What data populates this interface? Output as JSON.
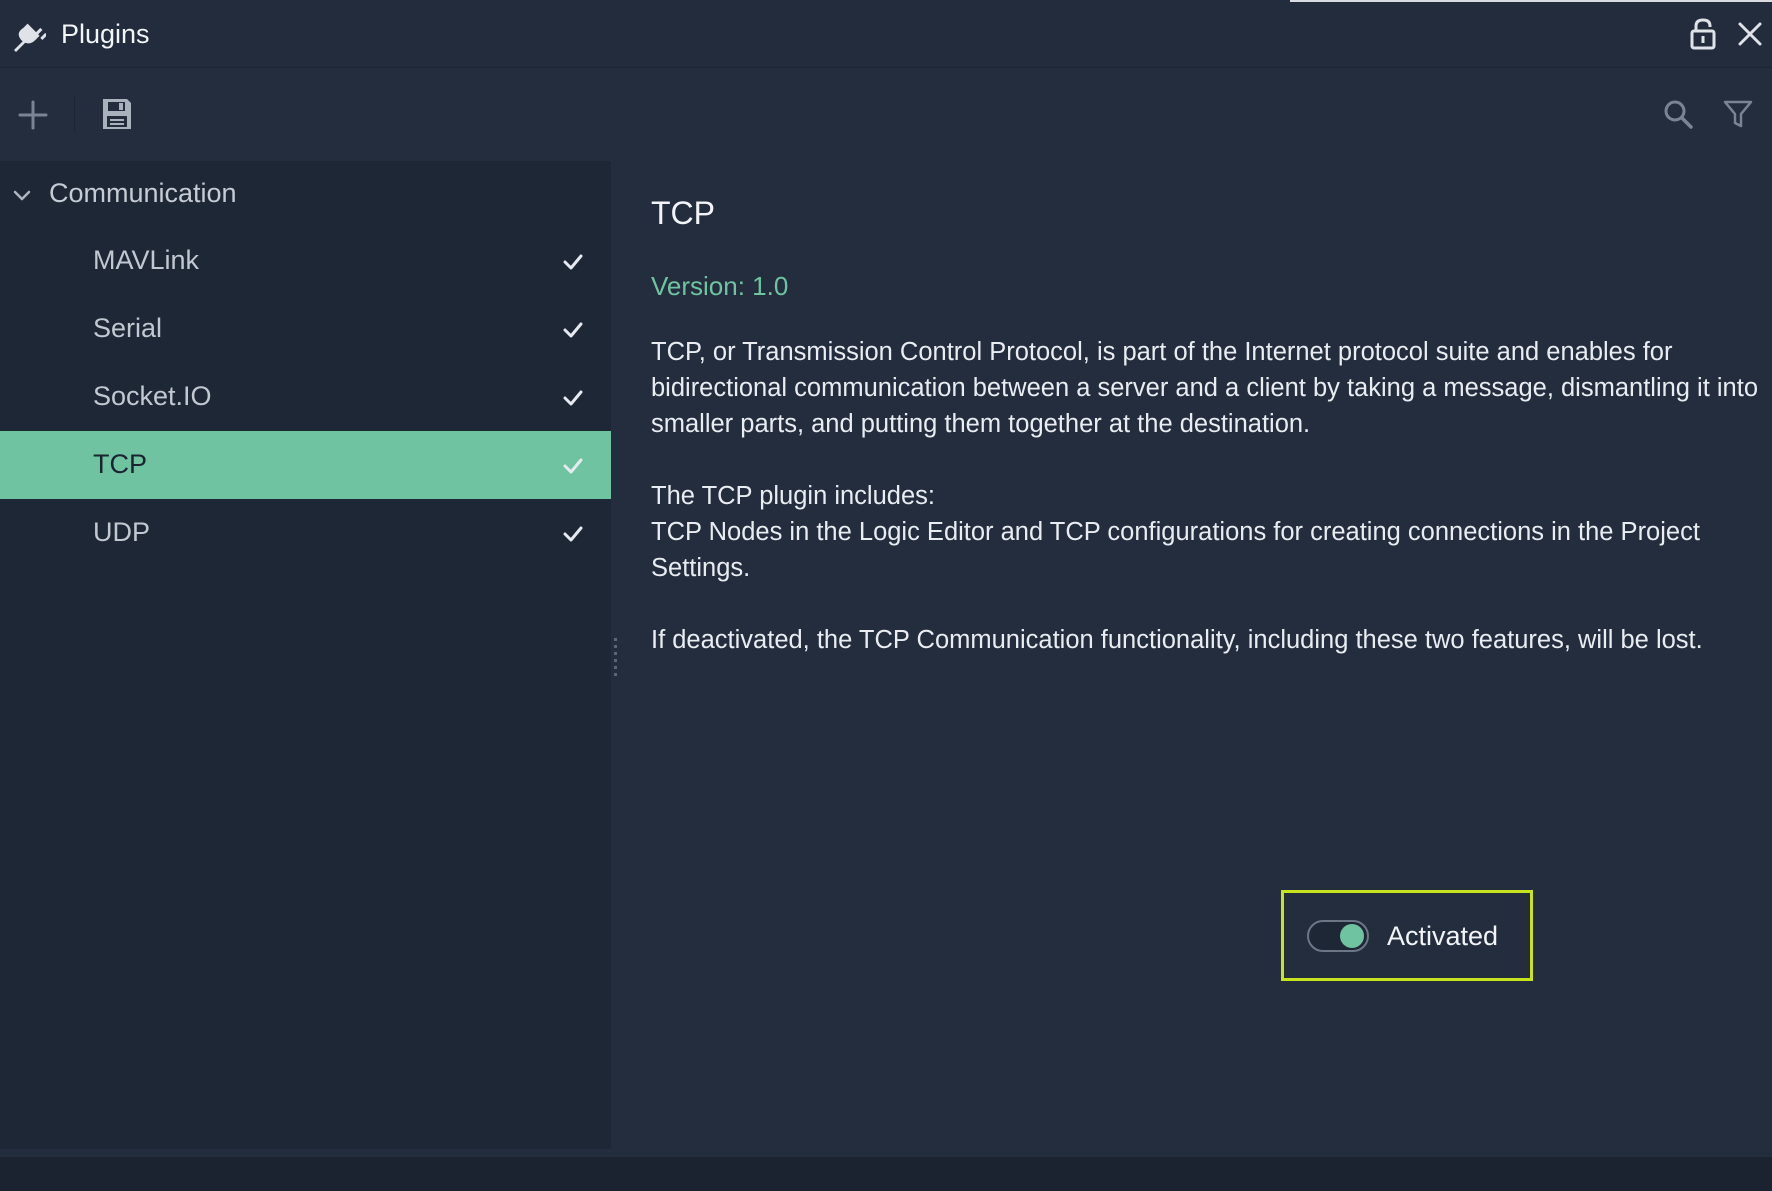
{
  "window": {
    "title": "Plugins",
    "title_icon": "plug-icon",
    "lock_icon": "lock-icon",
    "close_icon": "close-icon"
  },
  "toolbar": {
    "add_icon": "plus-icon",
    "save_icon": "floppy-disk-icon",
    "search_icon": "search-icon",
    "filter_icon": "filter-icon"
  },
  "sidebar": {
    "group": {
      "label": "Communication",
      "expanded": true
    },
    "items": [
      {
        "label": "MAVLink",
        "checked": true,
        "selected": false
      },
      {
        "label": "Serial",
        "checked": true,
        "selected": false
      },
      {
        "label": "Socket.IO",
        "checked": true,
        "selected": false
      },
      {
        "label": "TCP",
        "checked": true,
        "selected": true
      },
      {
        "label": "UDP",
        "checked": true,
        "selected": false
      }
    ]
  },
  "detail": {
    "title": "TCP",
    "version": "Version: 1.0",
    "paragraphs": [
      "TCP, or Transmission Control Protocol, is part of the Internet protocol suite and enables for bidirectional communication between a server and a client by taking a message, dismantling it into smaller parts, and putting them together at the destination.",
      "The TCP plugin includes:\nTCP Nodes in the Logic Editor and TCP configurations for creating connections in the Project Settings.",
      "If deactivated, the TCP Communication functionality, including these two features, will be lost."
    ],
    "toggle": {
      "label": "Activated",
      "on": true
    }
  },
  "colors": {
    "accent": "#6fc3a0",
    "highlight_border": "#c6e31d",
    "background": "#232d3d",
    "sidebar": "#1e2736"
  }
}
